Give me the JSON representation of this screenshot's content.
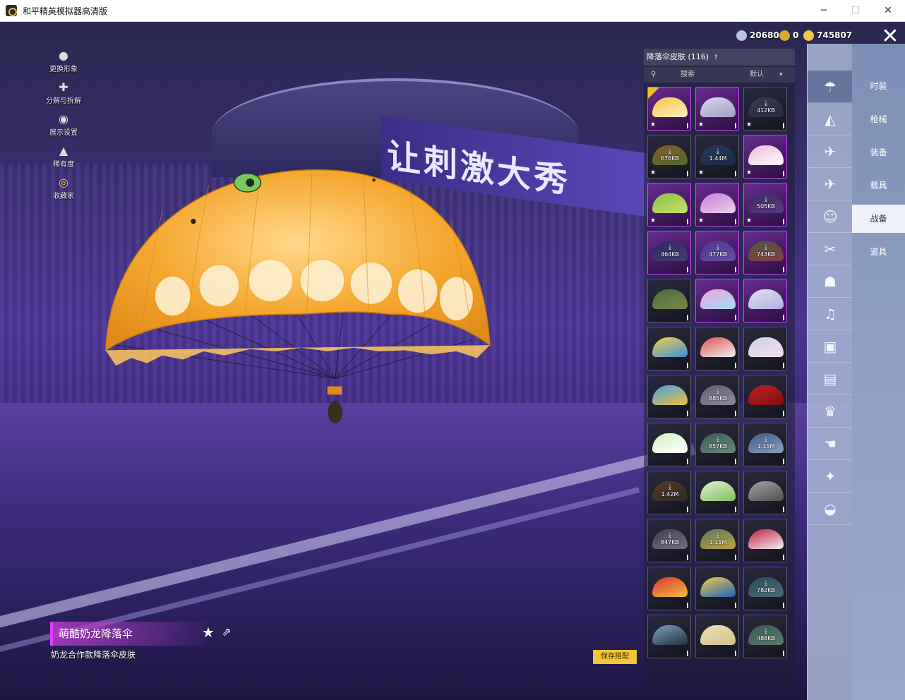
{
  "window": {
    "title": "和平精英模拟器高清版",
    "minimize": "─",
    "maximize": "☐",
    "close": "✕"
  },
  "side_menu": [
    {
      "label": "更换形象",
      "icon": "person-icon",
      "glyph": "●"
    },
    {
      "label": "分解与拆解",
      "icon": "puzzle-icon",
      "glyph": "✚"
    },
    {
      "label": "展示设置",
      "icon": "eye-icon",
      "glyph": "◉"
    },
    {
      "label": "稀有度",
      "icon": "flame-icon",
      "glyph": "▲"
    },
    {
      "label": "收藏家",
      "icon": "collector-badge-icon",
      "glyph": "◎"
    }
  ],
  "currency": [
    {
      "value": "20680",
      "color": "#b8c4e0"
    },
    {
      "value": "0",
      "color": "#d8a830"
    },
    {
      "value": "745807",
      "color": "#f0c84a"
    }
  ],
  "close_label": "✕",
  "panel": {
    "title": "降落伞皮肤 (116)",
    "help": "?",
    "search_icon": "⚲",
    "search_label": "搜索",
    "sort_label": "默认",
    "sort_chevron": "▾"
  },
  "tiles": [
    {
      "size": "",
      "purple": true,
      "checked": true,
      "star": true,
      "colors": [
        "#f7c24a",
        "#fff0c0"
      ]
    },
    {
      "size": "",
      "purple": true,
      "checked": false,
      "star": true,
      "colors": [
        "#d8d8e8",
        "#9fa0c8"
      ]
    },
    {
      "size": "412KB",
      "purple": false,
      "checked": false,
      "star": true,
      "colors": [
        "#3a3a55",
        "#2a2a40"
      ]
    },
    {
      "size": "676KB",
      "purple": false,
      "checked": false,
      "star": true,
      "colors": [
        "#8a5a2a",
        "#4a6a2a"
      ]
    },
    {
      "size": "1.44M",
      "purple": false,
      "checked": false,
      "star": true,
      "colors": [
        "#2a3a5a",
        "#1a2a4a"
      ]
    },
    {
      "size": "",
      "purple": true,
      "checked": false,
      "star": true,
      "colors": [
        "#f0b8d8",
        "#ffffff"
      ]
    },
    {
      "size": "",
      "purple": true,
      "checked": false,
      "star": true,
      "colors": [
        "#8ac040",
        "#c8e070"
      ]
    },
    {
      "size": "",
      "purple": true,
      "checked": false,
      "star": true,
      "colors": [
        "#c080d0",
        "#f0d0f0"
      ]
    },
    {
      "size": "505KB",
      "purple": true,
      "checked": false,
      "star": true,
      "colors": [
        "#3a2a60",
        "#5a3a80"
      ]
    },
    {
      "size": "464KB",
      "purple": true,
      "checked": false,
      "star": false,
      "colors": [
        "#2a2a5a",
        "#4a3a7a"
      ]
    },
    {
      "size": "477KB",
      "purple": true,
      "checked": false,
      "star": false,
      "colors": [
        "#4a3a8a",
        "#6a4aaa"
      ]
    },
    {
      "size": "743KB",
      "purple": true,
      "checked": false,
      "star": false,
      "colors": [
        "#4a5a3a",
        "#8a3a4a"
      ]
    },
    {
      "size": "",
      "purple": false,
      "checked": false,
      "star": false,
      "colors": [
        "#4a6a3a",
        "#7a8a4a"
      ]
    },
    {
      "size": "",
      "purple": true,
      "checked": false,
      "star": false,
      "colors": [
        "#f0a0e0",
        "#a0e0f0"
      ]
    },
    {
      "size": "",
      "purple": true,
      "checked": false,
      "star": false,
      "colors": [
        "#e0e0f0",
        "#b0b0e0"
      ]
    },
    {
      "size": "",
      "purple": false,
      "checked": false,
      "star": false,
      "colors": [
        "#f0d040",
        "#4090e0"
      ]
    },
    {
      "size": "",
      "purple": false,
      "checked": false,
      "star": false,
      "colors": [
        "#e05050",
        "#f0f0f0"
      ]
    },
    {
      "size": "",
      "purple": false,
      "checked": false,
      "star": false,
      "colors": [
        "#d0d0e0",
        "#f0e0f0"
      ]
    },
    {
      "size": "",
      "purple": false,
      "checked": false,
      "star": false,
      "colors": [
        "#40a0e0",
        "#f0c040"
      ]
    },
    {
      "size": "885KB",
      "purple": false,
      "checked": false,
      "star": false,
      "colors": [
        "#606070",
        "#8a8a9a"
      ]
    },
    {
      "size": "",
      "purple": false,
      "checked": false,
      "star": false,
      "colors": [
        "#c02020",
        "#801010"
      ]
    },
    {
      "size": "",
      "purple": false,
      "checked": false,
      "star": false,
      "colors": [
        "#d0f0c0",
        "#ffffff"
      ]
    },
    {
      "size": "857KB",
      "purple": false,
      "checked": false,
      "star": false,
      "colors": [
        "#3a5a5a",
        "#6a8a7a"
      ]
    },
    {
      "size": "1.15M",
      "purple": false,
      "checked": false,
      "star": false,
      "colors": [
        "#405a80",
        "#8aa0c0"
      ]
    },
    {
      "size": "1.42M",
      "purple": false,
      "checked": false,
      "star": false,
      "colors": [
        "#5a3a20",
        "#2a2a2a"
      ]
    },
    {
      "size": "",
      "purple": false,
      "checked": false,
      "star": false,
      "colors": [
        "#e0f0d0",
        "#80c060"
      ]
    },
    {
      "size": "",
      "purple": false,
      "checked": false,
      "star": false,
      "colors": [
        "#a0a0a0",
        "#505050"
      ]
    },
    {
      "size": "847KB",
      "purple": false,
      "checked": false,
      "star": false,
      "colors": [
        "#404050",
        "#707080"
      ]
    },
    {
      "size": "1.11M",
      "purple": false,
      "checked": false,
      "star": false,
      "colors": [
        "#5a7a5a",
        "#c0a040"
      ]
    },
    {
      "size": "",
      "purple": false,
      "checked": false,
      "star": false,
      "colors": [
        "#c02040",
        "#f0f0f0"
      ]
    },
    {
      "size": "",
      "purple": false,
      "checked": false,
      "star": false,
      "colors": [
        "#e03030",
        "#f0c040"
      ]
    },
    {
      "size": "",
      "purple": false,
      "checked": false,
      "star": false,
      "colors": [
        "#f0d040",
        "#2060c0"
      ]
    },
    {
      "size": "782KB",
      "purple": false,
      "checked": false,
      "star": false,
      "colors": [
        "#2a4a5a",
        "#4a6a7a"
      ]
    },
    {
      "size": "",
      "purple": false,
      "checked": false,
      "star": false,
      "colors": [
        "#80a0c0",
        "#203040"
      ]
    },
    {
      "size": "",
      "purple": false,
      "checked": false,
      "star": false,
      "colors": [
        "#f0e0b0",
        "#d0c090"
      ]
    },
    {
      "size": "488KB",
      "purple": false,
      "checked": false,
      "star": false,
      "colors": [
        "#3a5a50",
        "#5a7a70"
      ]
    }
  ],
  "categories": [
    {
      "icon": "parachute-icon",
      "glyph": "☂",
      "active": true
    },
    {
      "icon": "glider-icon",
      "glyph": "◭",
      "active": false
    },
    {
      "icon": "plane-trail-icon",
      "glyph": "✈",
      "active": false
    },
    {
      "icon": "aircraft-icon",
      "glyph": "✈",
      "active": false
    },
    {
      "icon": "emote-icon",
      "glyph": "☺",
      "active": false
    },
    {
      "icon": "tools-icon",
      "glyph": "✂",
      "active": false
    },
    {
      "icon": "robot-icon",
      "glyph": "☗",
      "active": false
    },
    {
      "icon": "speaker-icon",
      "glyph": "♫",
      "active": false
    },
    {
      "icon": "gamepad-icon",
      "glyph": "▣",
      "active": false
    },
    {
      "icon": "picture-icon",
      "glyph": "▤",
      "active": false
    },
    {
      "icon": "trophy-icon",
      "glyph": "♛",
      "active": false
    },
    {
      "icon": "hand-icon",
      "glyph": "☚",
      "active": false
    },
    {
      "icon": "magic-wand-icon",
      "glyph": "✦",
      "active": false
    },
    {
      "icon": "bowl-icon",
      "glyph": "◒",
      "active": false
    }
  ],
  "tabs": [
    {
      "label": "时装",
      "active": false
    },
    {
      "label": "枪械",
      "active": false
    },
    {
      "label": "装备",
      "active": false
    },
    {
      "label": "载具",
      "active": false
    },
    {
      "label": "战备",
      "active": true
    },
    {
      "label": "道具",
      "active": false
    }
  ],
  "scene": {
    "banner": "让刺激大秀"
  },
  "item": {
    "name": "萌酷奶龙降落伞",
    "desc": "奶龙合作款降落伞皮肤",
    "star": "★",
    "share": "⇗"
  },
  "save_label": "保存搭配"
}
